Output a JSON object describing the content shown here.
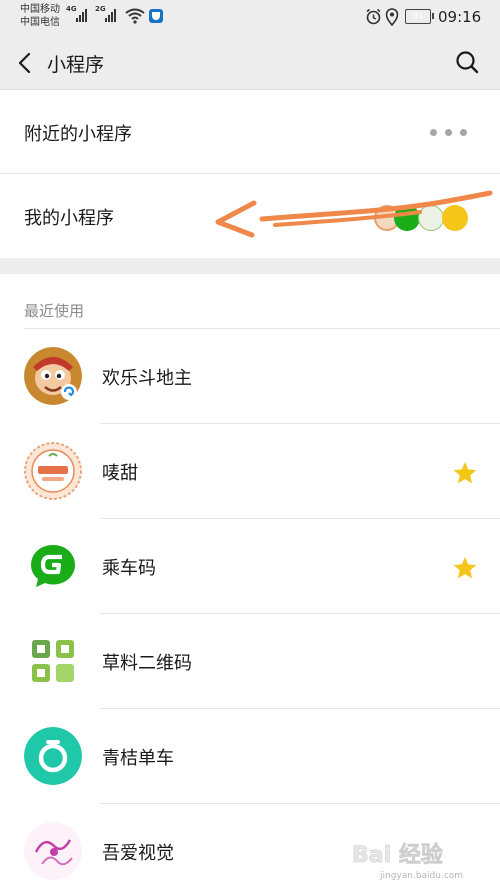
{
  "status_bar": {
    "carrier_1": "中国移动",
    "carrier_2": "中国电信",
    "sim1_tag": "4G",
    "sim2_tag": "2G",
    "battery": "91",
    "time": "09:16"
  },
  "nav": {
    "title": "小程序",
    "back_icon": "chevron-left-icon",
    "search_icon": "search-icon"
  },
  "top": {
    "nearby_label": "附近的小程序",
    "mine_label": "我的小程序",
    "annotation": "hand-drawn orange arrow pointing to 我的小程序"
  },
  "recent": {
    "title": "最近使用",
    "items": [
      {
        "name": "欢乐斗地主",
        "starred": false,
        "icon": "doudizhu-icon"
      },
      {
        "name": "唛甜",
        "starred": true,
        "icon": "maitian-icon"
      },
      {
        "name": "乘车码",
        "starred": true,
        "icon": "chengchema-icon"
      },
      {
        "name": "草料二维码",
        "starred": false,
        "icon": "caoliao-qrcode-icon"
      },
      {
        "name": "青桔单车",
        "starred": false,
        "icon": "qingju-bike-icon"
      },
      {
        "name": "吾爱视觉",
        "starred": false,
        "icon": "wuai-shijue-icon"
      }
    ]
  },
  "colors": {
    "background": "#ededed",
    "star": "#f5c518",
    "annotation": "#f0884a",
    "green": "#1aad19"
  },
  "watermark": {
    "text": "Bai 经验",
    "url": "jingyan.baidu.com"
  }
}
